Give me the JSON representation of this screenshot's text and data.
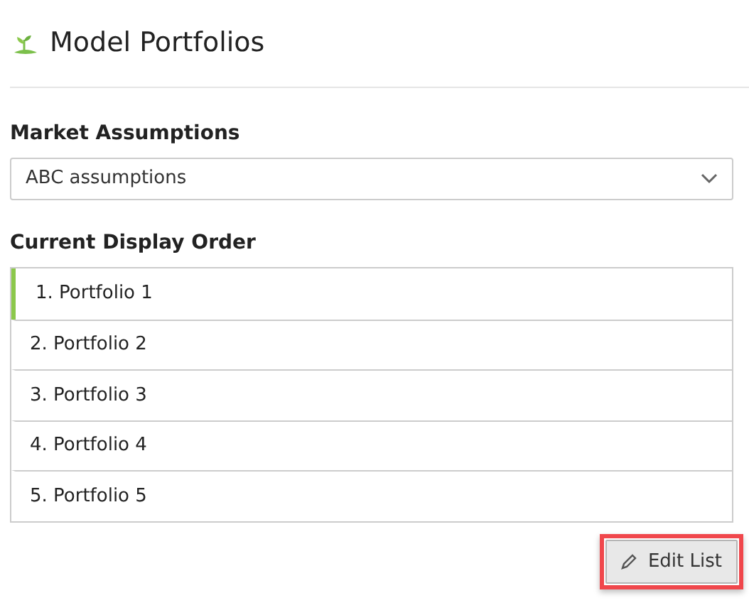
{
  "header": {
    "title": "Model Portfolios"
  },
  "market_assumptions": {
    "label": "Market Assumptions",
    "value": "ABC assumptions"
  },
  "display_order": {
    "label": "Current Display Order",
    "items": [
      {
        "label": "1. Portfolio 1",
        "selected": true
      },
      {
        "label": "2. Portfolio 2",
        "selected": false
      },
      {
        "label": "3. Portfolio 3",
        "selected": false
      },
      {
        "label": "4. Portfolio 4",
        "selected": false
      },
      {
        "label": "5. Portfolio 5",
        "selected": false
      }
    ]
  },
  "edit_button": {
    "label": "Edit List",
    "highlighted": true
  }
}
